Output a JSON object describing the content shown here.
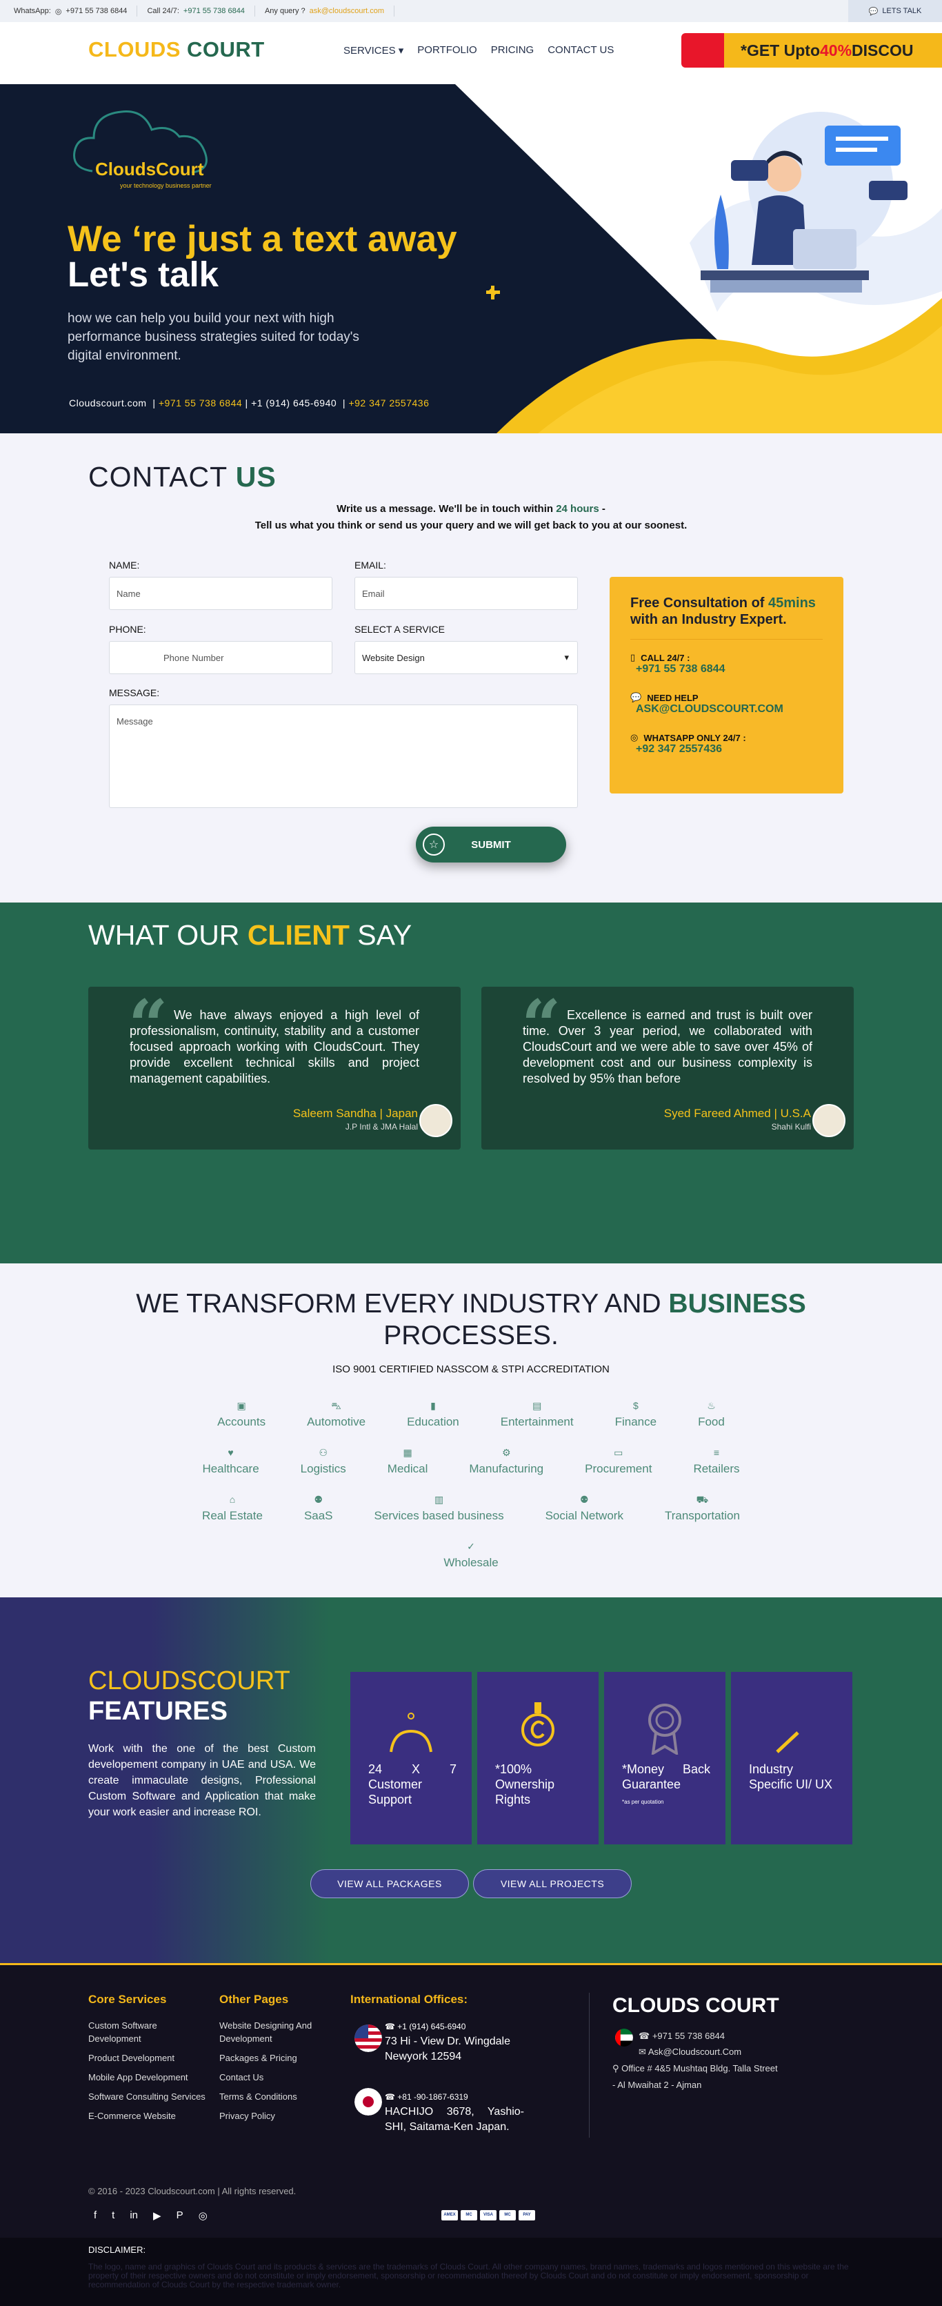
{
  "topbar": {
    "whatsapp_label": "WhatsApp:",
    "whatsapp_number": "+971 55 738 6844",
    "call_label": "Call 24/7:",
    "call_number": "+971 55 738 6844",
    "query_label": "Any query ?",
    "query_email": "ask@cloudscourt.com",
    "lets_talk": "LETS TALK"
  },
  "nav": {
    "logo_part1": "CLOUDS",
    "logo_part2": "COURT",
    "items": [
      "SERVICES ▾",
      "PORTFOLIO",
      "PRICING",
      "CONTACT US"
    ],
    "promo_prefix": "*GET Upto ",
    "promo_highlight": "40%",
    "promo_suffix": " DISCOU"
  },
  "hero": {
    "brand": "CloudsCourt",
    "tagline": "your technology business partner",
    "line1": "We ‘re just a text away",
    "line2": "Let's talk",
    "paragraph": " how we can help you build your next with high performance business strategies suited for today's digital environment.",
    "site": "Cloudscourt.com",
    "phone1": "+971 55 738 6844",
    "phone2": "+1 (914) 645-6940",
    "phone3": "+92 347 2557436"
  },
  "contact": {
    "title1": "CONTACT",
    "title2": "US",
    "sub1_pre": "Write us a message. We'll be in touch within ",
    "sub1_hl": "24 hours",
    "sub1_post": " -",
    "sub2": "Tell us what you think or send us your query and we will get back to you at our soonest.",
    "name_label": "NAME:",
    "name_ph": "Name",
    "email_label": "EMAIL:",
    "email_ph": "Email",
    "phone_label": "PHONE:",
    "phone_ph": "Phone Number",
    "service_label": "SELECT A SERVICE",
    "service_value": "Website Design",
    "message_label": "MESSAGE:",
    "message_ph": "Message",
    "submit": "SUBMIT"
  },
  "consult": {
    "title_pre": "Free Consultation of ",
    "title_hl": "45mins",
    "title_post": "with an Industry Expert.",
    "call_label": "CALL 24/7 :",
    "call_value": "+971 55 738 6844",
    "help_label": "NEED HELP",
    "help_value": "ASK@CLOUDSCOURT.COM",
    "wa_label": "WHATSAPP ONLY 24/7 :",
    "wa_value": "+92 347 2557436"
  },
  "clients": {
    "title_pre": "WHAT OUR ",
    "title_hl": "CLIENT",
    "title_post": " SAY",
    "testimonials": [
      {
        "text": "We have always enjoyed a high level of professionalism, continuity, stability and a customer focused approach working with CloudsCourt. They provide excellent technical skills and project management capabilities.",
        "name": "Saleem Sandha | Japan",
        "company": "J.P Intl & JMA Halal"
      },
      {
        "text": "Excellence is earned and trust is built over time. Over 3 year period, we collaborated with CloudsCourt and we were able to save over 45% of development cost and our business complexity is resolved by 95% than before",
        "name": "Syed Fareed Ahmed | U.S.A",
        "company": "Shahi Kulfi"
      }
    ]
  },
  "industry": {
    "title_pre": "WE TRANSFORM EVERY INDUSTRY AND ",
    "title_hl": "BUSINESS",
    "title_post": "PROCESSES.",
    "iso": "ISO 9001 CERTIFIED NASSCOM & STPI ACCREDITATION",
    "rows": [
      [
        "Accounts",
        "Automotive",
        "Education",
        "Entertainment",
        "Finance",
        "Food"
      ],
      [
        "Healthcare",
        "Logistics",
        "Medical",
        "Manufacturing",
        "Procurement",
        "Retailers"
      ],
      [
        "Real Estate",
        "SaaS",
        "Services based business",
        "Social Network",
        "Transportation"
      ],
      [
        "Wholesale"
      ]
    ],
    "icons": [
      [
        "▣",
        "⛍",
        "▮",
        "▤",
        "$",
        "♨"
      ],
      [
        "♥",
        "⚇",
        "▦",
        "⚙",
        "▭",
        "≡"
      ],
      [
        "⌂",
        "⚉",
        "▥",
        "⚉",
        "⛟"
      ],
      [
        "✓"
      ]
    ]
  },
  "features": {
    "title1": "CLOUDSCOURT",
    "title2": "FEATURES",
    "description": "Work with the one of the best Custom developement company in UAE and USA. We create immaculate designs, Professional Custom Software and Application that make your work easier and increase ROI.",
    "cards": [
      {
        "text": "24 X 7 Customer Support",
        "note": ""
      },
      {
        "text": "*100% Ownership Rights",
        "note": ""
      },
      {
        "text": "*Money Back Guarantee",
        "note": "*as per quotation"
      },
      {
        "text": "Industry Specific UI/ UX",
        "note": ""
      }
    ],
    "btn_packages": "VIEW ALL PACKAGES",
    "btn_projects": "VIEW ALL PROJECTS"
  },
  "footer": {
    "core_title": "Core Services",
    "core_links": [
      "Custom Software Development",
      "Product Development",
      "Mobile App Development",
      "Software Consulting Services",
      "E-Commerce Website"
    ],
    "other_title": "Other Pages",
    "other_links": [
      "Website Designing And Development",
      "Packages & Pricing",
      "Contact Us",
      "Terms & Conditions",
      "Privacy Policy"
    ],
    "intl_title": "International Offices:",
    "usa_phone": "+1 (914) 645-6940",
    "usa_address": "73 Hi - View Dr. Wingdale Newyork 12594",
    "jp_phone": "+81 -90-1867-6319",
    "jp_address": "HACHIJO 3678, Yashio-SHI, Saitama-Ken Japan.",
    "brand": "CLOUDS COURT",
    "uae_phone": "+971 55 738 6844",
    "uae_email": "Ask@Cloudscourt.Com",
    "uae_office1": "Office # 4&5 Mushtaq Bldg. Talla Street",
    "uae_office2": "- Al Mwaihat 2 - Ajman",
    "copyright": "© 2016 - 2023 Cloudscourt.com | All rights reserved.",
    "social": [
      "f",
      "t",
      "in",
      "▶",
      "P",
      "◎"
    ],
    "cards": [
      "AMEX",
      "MC",
      "VISA",
      "MC",
      "PAY"
    ]
  },
  "disclaimer": {
    "title": "DISCLAIMER:",
    "text": "The logo, name and graphics of Clouds Court and its products & services are the trademarks of Clouds Court. All other company names, brand names, trademarks and logos mentioned on this website are the property of their respective owners and do not constitute or imply endorsement, sponsorship or recommendation thereof by Clouds Court and do not constitute or imply endorsement, sponsorship or recommendation of Clouds Court by the respective trademark owner."
  },
  "colors": {
    "brand_green": "#25684f",
    "brand_yellow": "#f5b81a",
    "navy": "#0f1a30",
    "promo_red": "#e8162a",
    "feature_purple": "#3a2f80"
  }
}
